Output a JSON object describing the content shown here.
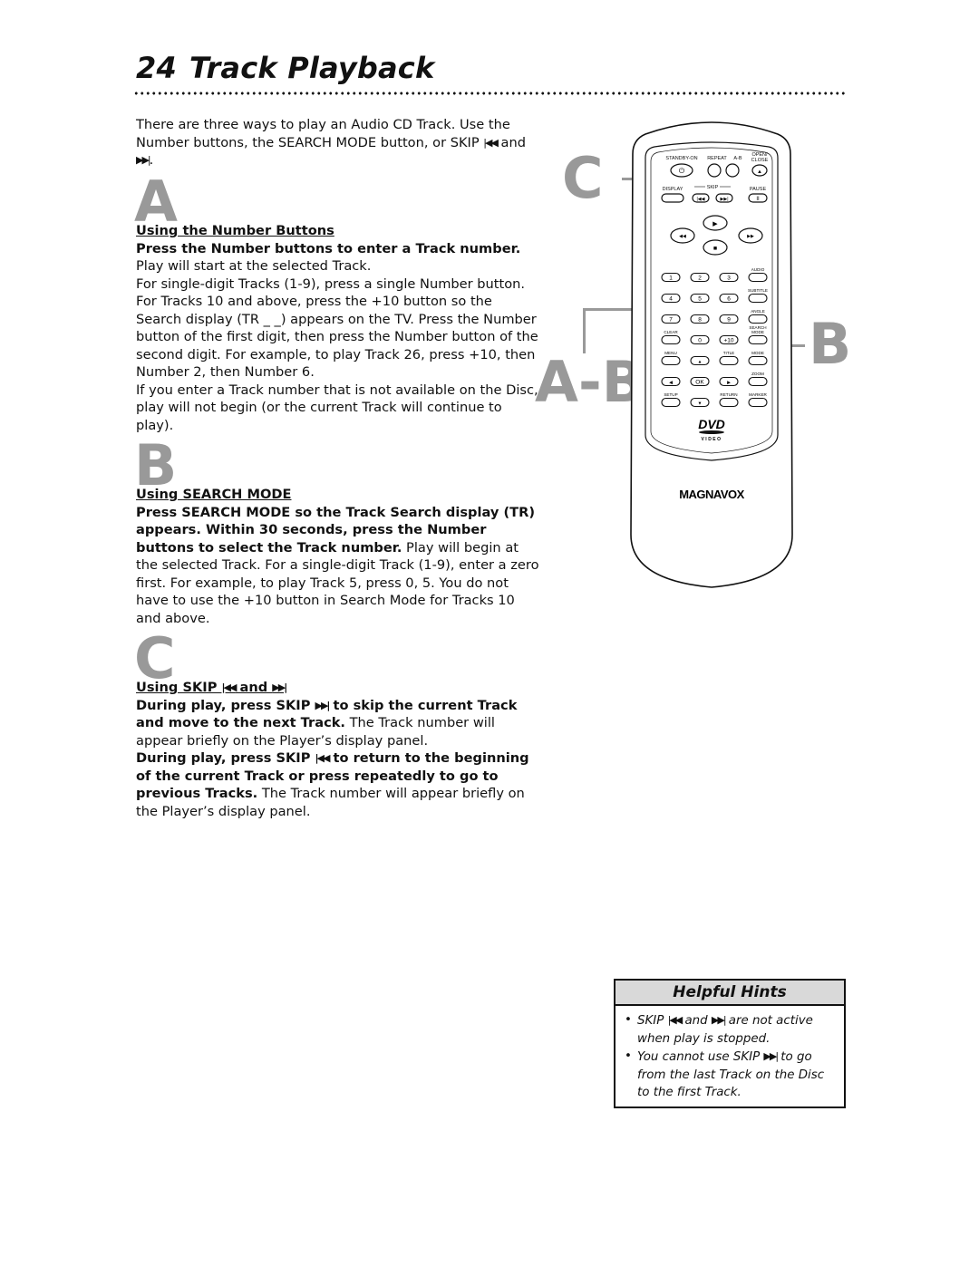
{
  "page": {
    "number": "24",
    "title": "Track Playback"
  },
  "intro": {
    "text_before": "There are three ways to play an Audio CD Track. Use the Number buttons, the SEARCH MODE button, or SKIP ",
    "skip_back": "|◀◀",
    "and": " and ",
    "skip_fwd": "▶▶|",
    "end": "."
  },
  "sections": {
    "a": {
      "letter": "A",
      "heading": "Using the Number Buttons",
      "bold_lead": "Press the Number buttons to enter a Track number.",
      "p1": "Play will start at the selected Track.",
      "p2": "For single-digit Tracks (1-9), press a single Number button. For Tracks 10 and above, press the +10 button so the Search display (TR _ _) appears on the TV. Press the Number button of the first digit, then press the Number button of the second digit. For example, to play Track 26, press +10, then Number 2, then Number 6.",
      "p3": "If you enter a Track number that is not available on the Disc, play will not begin (or the current Track will continue to play)."
    },
    "b": {
      "letter": "B",
      "heading": "Using SEARCH MODE",
      "bold_lead": "Press SEARCH MODE so the Track Search display (TR) appears. Within 30 seconds, press the Number buttons to select the Track number.",
      "rest": " Play will begin at the selected Track. For a single-digit Track (1-9), enter a zero first. For example, to play Track 5, press 0, 5. You do not have to use the +10 button in Search Mode for Tracks 10 and above."
    },
    "c": {
      "letter": "C",
      "heading_prefix": "Using SKIP ",
      "heading_back": "|◀◀",
      "heading_and": " and ",
      "heading_fwd": "▶▶|",
      "bold1_a": "During play, press SKIP ",
      "bold1_glyph": "▶▶|",
      "bold1_b": " to skip the current Track and move to the next Track.",
      "rest1": " The Track number will appear briefly on the Player’s display panel.",
      "bold2_a": "During play, press SKIP ",
      "bold2_glyph": "|◀◀",
      "bold2_b": " to return to the beginning of the current Track or press repeatedly to go to previous Tracks.",
      "rest2": " The Track number will appear briefly on the Player’s display panel."
    }
  },
  "callouts": {
    "c": "C",
    "ab": "A-B",
    "b": "B"
  },
  "remote": {
    "brand": "MAGNAVOX",
    "logo_top": "DVD",
    "logo_bottom": "VIDEO",
    "labels": {
      "standby": "STANDBY-ON",
      "repeat": "REPEAT",
      "ab": "A-B",
      "open1": "OPEN/",
      "open2": "CLOSE",
      "display": "DISPLAY",
      "skip": "SKIP",
      "pause": "PAUSE",
      "audio": "AUDIO",
      "subtitle": "SUBTITLE",
      "angle": "ANGLE",
      "clear": "CLEAR",
      "search1": "SEARCH",
      "search2": "MODE",
      "menu": "MENU",
      "title": "TITLE",
      "mode": "MODE",
      "zoom": "ZOOM",
      "setup": "SETUP",
      "return": "RETURN",
      "marker": "MARKER",
      "ok": "OK",
      "plus10": "+10",
      "n1": "1",
      "n2": "2",
      "n3": "3",
      "n4": "4",
      "n5": "5",
      "n6": "6",
      "n7": "7",
      "n8": "8",
      "n9": "9",
      "n0": "0"
    }
  },
  "hints": {
    "title": "Helpful Hints",
    "items": [
      {
        "a": "SKIP ",
        "g1": "|◀◀",
        "b": " and ",
        "g2": "▶▶|",
        "c": " are not active when play is stopped."
      },
      {
        "a": "You cannot use SKIP ",
        "g1": "▶▶|",
        "b": " to go from the last Track on the Disc to the first Track."
      }
    ]
  }
}
